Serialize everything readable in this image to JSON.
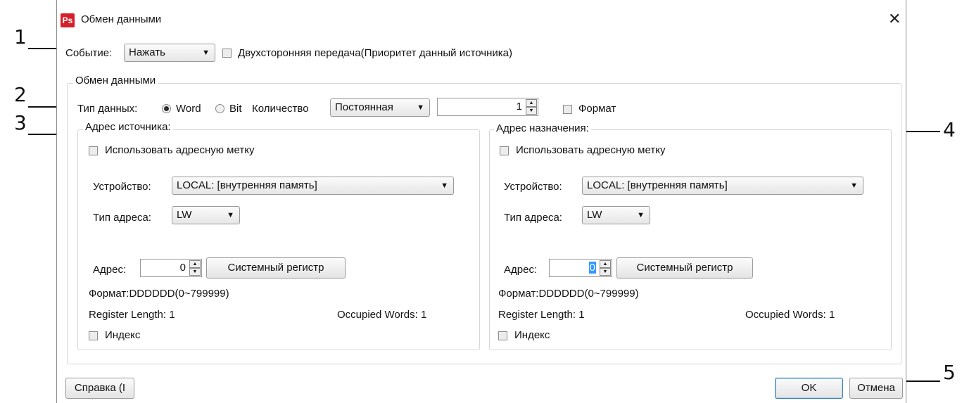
{
  "window": {
    "title": "Обмен данными",
    "icon_text": "Ps",
    "close_glyph": "✕"
  },
  "event": {
    "label": "Событие:",
    "value": "Нажать",
    "two_way_label": "Двухсторонняя передача(Приоритет данный источника)"
  },
  "exchange": {
    "group_label": "Обмен данными",
    "data_type_label": "Тип данных:",
    "word_label": "Word",
    "bit_label": "Bit",
    "count_label": "Количество",
    "count_mode": "Постоянная",
    "count_value": "1",
    "format_label": "Формат"
  },
  "source": {
    "group_label": "Адрес источника:",
    "use_tag_label": "Использовать адресную метку",
    "device_label": "Устройство:",
    "device_value": "LOCAL: [внутренняя память]",
    "addr_type_label": "Тип адреса:",
    "addr_type_value": "LW",
    "address_label": "Адрес:",
    "address_value": "0",
    "sysreg_button": "Системный регистр",
    "format_text": "Формат:DDDDDD(0~799999)",
    "reg_length": "Register Length: 1",
    "occupied_words": "Occupied Words: 1",
    "index_label": "Индекс"
  },
  "target": {
    "group_label": "Адрес назначения:",
    "use_tag_label": "Использовать адресную метку",
    "device_label": "Устройство:",
    "device_value": "LOCAL: [внутренняя память]",
    "addr_type_label": "Тип адреса:",
    "addr_type_value": "LW",
    "address_label": "Адрес:",
    "address_value": "0",
    "sysreg_button": "Системный регистр",
    "format_text": "Формат:DDDDDD(0~799999)",
    "reg_length": "Register Length: 1",
    "occupied_words": "Occupied Words: 1",
    "index_label": "Индекс"
  },
  "footer": {
    "help_button": "Справка (I",
    "ok_button": "OK",
    "cancel_button": "Отмена"
  },
  "callouts": {
    "c1": "1",
    "c2": "2",
    "c3": "3",
    "c4": "4",
    "c5": "5"
  },
  "colors": {
    "brand_icon": "#d4202a",
    "focus_border": "#3c7fb1"
  }
}
